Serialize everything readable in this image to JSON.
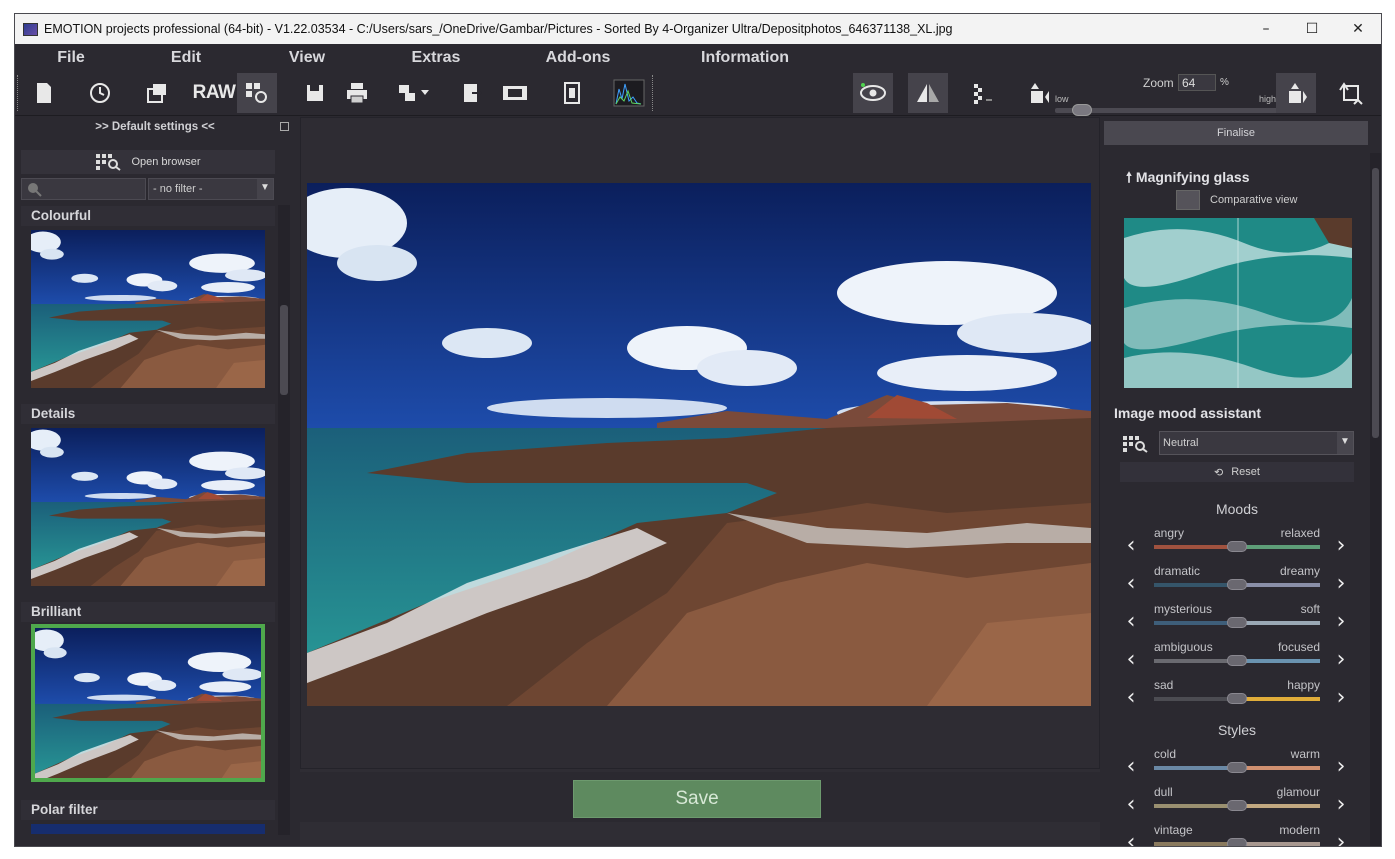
{
  "window": {
    "title": "EMOTION projects professional (64-bit) - V1.22.03534 - C:/Users/sars_/OneDrive/Gambar/Pictures - Sorted By 4-Organizer Ultra/Depositphotos_646371138_XL.jpg",
    "minimize": "–",
    "maximize": "☐",
    "close": "✕"
  },
  "menu": [
    "File",
    "Edit",
    "View",
    "Extras",
    "Add-ons",
    "Information"
  ],
  "toolbar": {
    "raw_label": "RAW",
    "zoom_label": "Zoom",
    "zoom_value": "64",
    "zoom_unit": "%",
    "zoom_low": "low",
    "zoom_high": "high",
    "zoom_level_fraction": 0.08
  },
  "left_panel": {
    "header": ">> Default settings <<",
    "open_browser": "Open browser",
    "filter": "- no filter -",
    "presets": [
      "Colourful",
      "Details",
      "Brilliant",
      "Polar filter"
    ],
    "selected_preset": "Brilliant"
  },
  "center": {
    "save_label": "Save"
  },
  "right_panel": {
    "finalise": "Finalise",
    "magnifying_glass": "Magnifying glass",
    "comparative_view": "Comparative view",
    "mood_assistant": "Image mood assistant",
    "mood_selected": "Neutral",
    "reset": "Reset",
    "moods_title": "Moods",
    "styles_title": "Styles",
    "moods": [
      {
        "left": "angry",
        "right": "relaxed",
        "value": 0.5,
        "color_left": "#a0523f",
        "color_right": "#5e9e78"
      },
      {
        "left": "dramatic",
        "right": "dreamy",
        "value": 0.5,
        "color_left": "#35556a",
        "color_right": "#8a8fa8"
      },
      {
        "left": "mysterious",
        "right": "soft",
        "value": 0.5,
        "color_left": "#3e5e7a",
        "color_right": "#9aa8b5"
      },
      {
        "left": "ambiguous",
        "right": "focused",
        "value": 0.5,
        "color_left": "#6a6a70",
        "color_right": "#6a93b0"
      },
      {
        "left": "sad",
        "right": "happy",
        "value": 0.5,
        "color_left": "#4c4c52",
        "color_right": "#e0ad3a"
      }
    ],
    "styles": [
      {
        "left": "cold",
        "right": "warm",
        "value": 0.5,
        "color_left": "#6a88a5",
        "color_right": "#d09070"
      },
      {
        "left": "dull",
        "right": "glamour",
        "value": 0.5,
        "color_left": "#9a9070",
        "color_right": "#c2a880"
      },
      {
        "left": "vintage",
        "right": "modern",
        "value": 0.5,
        "color_left": "#8a7a5e",
        "color_right": "#a89890"
      }
    ]
  }
}
